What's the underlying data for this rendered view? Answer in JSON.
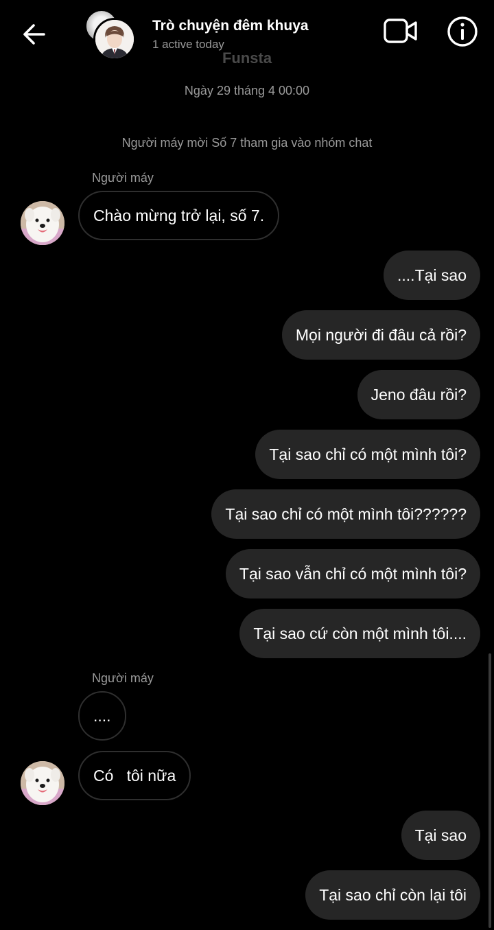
{
  "header": {
    "back_icon": "arrow-left-icon",
    "title": "Trò chuyện đêm khuya",
    "status": "1 active today",
    "video_icon": "video-call-icon",
    "info_icon": "info-icon"
  },
  "sub_label": "Funsta",
  "timestamp": "Ngày 29 tháng 4 00:00",
  "system_message": "Người máy mời Số 7 tham gia vào nhóm chat",
  "messages": [
    {
      "type": "sender",
      "text": "Người máy"
    },
    {
      "type": "incoming",
      "text": "Chào mừng trở lại, số 7."
    },
    {
      "type": "outgoing",
      "text": "....Tại sao"
    },
    {
      "type": "outgoing",
      "text": "Mọi người đi đâu cả rồi?"
    },
    {
      "type": "outgoing",
      "text": "Jeno đâu rồi?"
    },
    {
      "type": "outgoing",
      "text": "Tại sao chỉ có một mình tôi?"
    },
    {
      "type": "outgoing",
      "text": "Tại sao chỉ có một mình tôi??????"
    },
    {
      "type": "outgoing",
      "text": "Tại sao vẫn chỉ có một mình tôi?"
    },
    {
      "type": "outgoing",
      "text": "Tại sao cứ còn một mình tôi...."
    },
    {
      "type": "sender",
      "text": "Người máy"
    },
    {
      "type": "incoming",
      "text": "...."
    },
    {
      "type": "incoming",
      "text": "Có   tôi nữa"
    },
    {
      "type": "outgoing",
      "text": "Tại sao"
    },
    {
      "type": "outgoing",
      "text": "Tại sao chỉ còn lại tôi"
    }
  ],
  "colors": {
    "background": "#000000",
    "outgoing_bubble": "#262626",
    "incoming_border": "#2f2f2f",
    "muted_text": "#9a9a9a"
  }
}
